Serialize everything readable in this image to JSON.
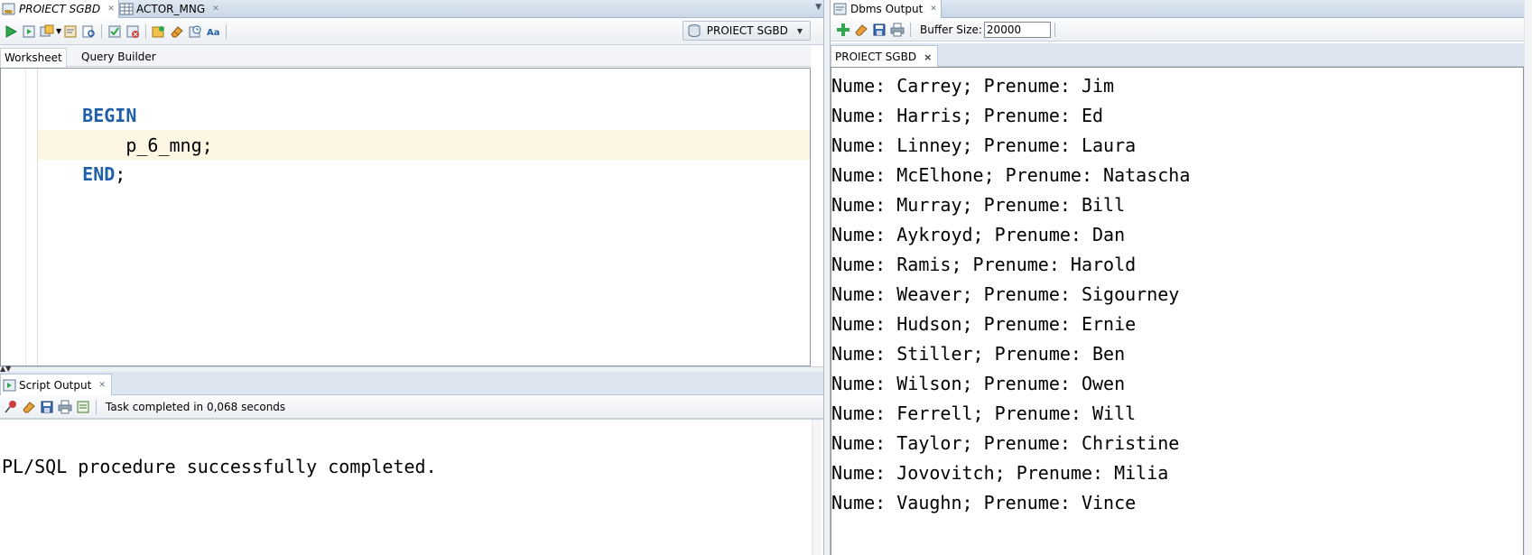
{
  "left_tabs": [
    {
      "label": "PROIECT SGBD",
      "icon": "sql-worksheet-icon"
    },
    {
      "label": "ACTOR_MNG",
      "icon": "table-icon"
    }
  ],
  "connection_selector": {
    "label": "PROIECT SGBD",
    "icon": "database-connection-icon"
  },
  "worksheet_tabs": [
    "Worksheet",
    "Query Builder"
  ],
  "editor": {
    "lines": [
      {
        "kw": "BEGIN",
        "rest": ""
      },
      {
        "kw": "",
        "rest": "    p_6_mng;"
      },
      {
        "kw": "END",
        "rest": ";"
      }
    ]
  },
  "script_output": {
    "tab_label": "Script Output",
    "status": "Task completed in 0,068 seconds",
    "text": "PL/SQL procedure successfully completed."
  },
  "dbms_output": {
    "tab_label": "Dbms Output",
    "buffer_label": "Buffer Size:",
    "buffer_value": "20000",
    "connection_tab": "PROIECT SGBD",
    "lines": [
      "Nume: Carrey; Prenume: Jim",
      "Nume: Harris; Prenume: Ed",
      "Nume: Linney; Prenume: Laura",
      "Nume: McElhone; Prenume: Natascha",
      "Nume: Murray; Prenume: Bill",
      "Nume: Aykroyd; Prenume: Dan",
      "Nume: Ramis; Prenume: Harold",
      "Nume: Weaver; Prenume: Sigourney",
      "Nume: Hudson; Prenume: Ernie",
      "Nume: Stiller; Prenume: Ben",
      "Nume: Wilson; Prenume: Owen",
      "Nume: Ferrell; Prenume: Will",
      "Nume: Taylor; Prenume: Christine",
      "Nume: Jovovitch; Prenume: Milia",
      "Nume: Vaughn; Prenume: Vince"
    ]
  },
  "colors": {
    "keyword": "#1f5fa8",
    "current_line": "#fdf6e3",
    "tab_strip": "#c9d7e6"
  }
}
